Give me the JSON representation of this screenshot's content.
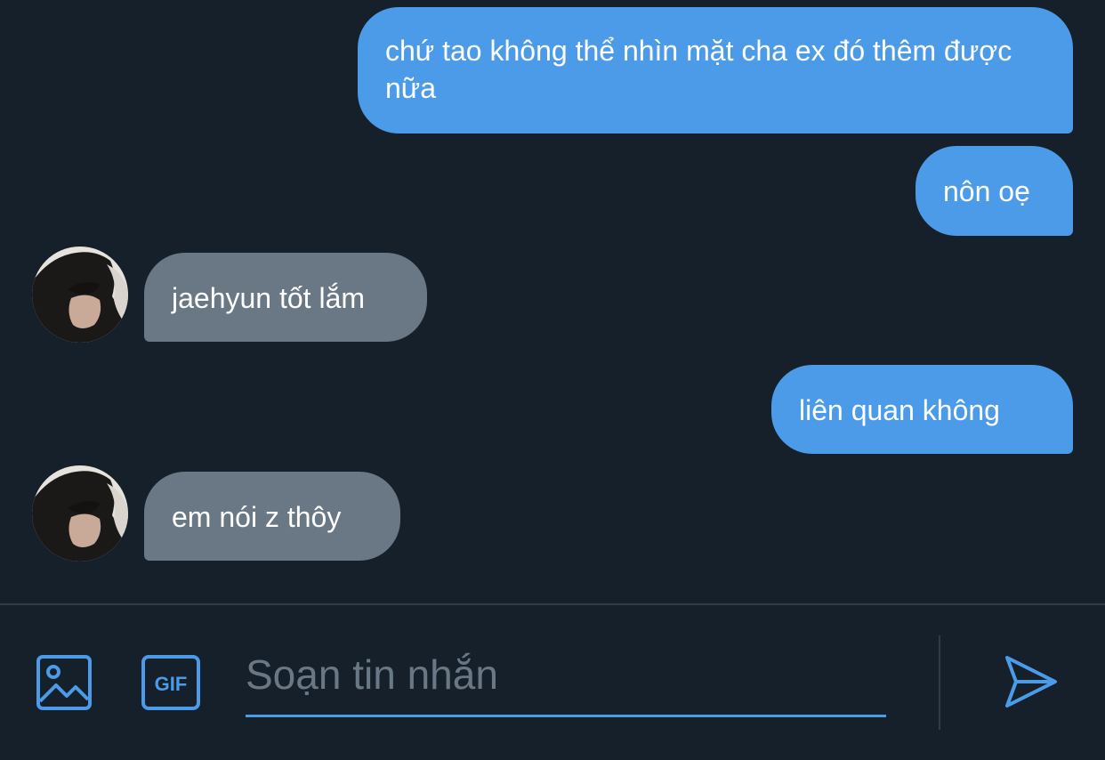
{
  "colors": {
    "background": "#15202b",
    "outgoing_bubble": "#4b9be8",
    "incoming_bubble": "#6a7885",
    "accent": "#4b9be8",
    "placeholder": "#6a7885"
  },
  "messages": [
    {
      "direction": "outgoing",
      "text": "chứ tao không thể nhìn mặt cha ex đó thêm được nữa"
    },
    {
      "direction": "outgoing",
      "text": "nôn oẹ"
    },
    {
      "direction": "incoming",
      "text": "jaehyun tốt lắm"
    },
    {
      "direction": "outgoing",
      "text": "liên quan không"
    },
    {
      "direction": "incoming",
      "text": "em nói z thôy"
    }
  ],
  "composer": {
    "placeholder": "Soạn tin nhắn",
    "value": "",
    "gif_label": "GIF",
    "icons": [
      "image-icon",
      "gif-icon",
      "send-icon"
    ]
  }
}
